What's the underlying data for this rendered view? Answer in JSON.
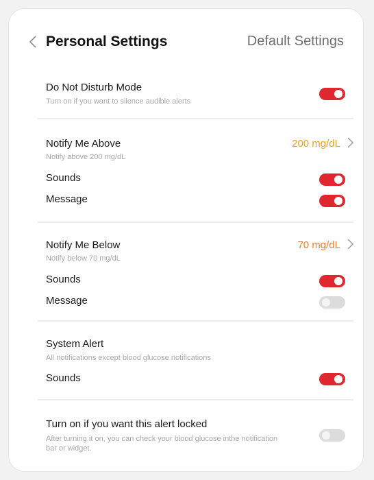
{
  "header": {
    "title": "Personal Settings",
    "default_link": "Default Settings"
  },
  "dnd": {
    "title": "Do Not Disturb Mode",
    "subtitle": "Turn on if you want to silence audible alerts",
    "enabled": true
  },
  "above": {
    "title": "Notify Me Above",
    "subtitle": "Notify above 200 mg/dL",
    "value": "200 mg/dL",
    "value_color": "#e8a21c",
    "sounds_label": "Sounds",
    "sounds_on": true,
    "message_label": "Message",
    "message_on": true
  },
  "below": {
    "title": "Notify Me Below",
    "subtitle": "Notify below 70 mg/dL",
    "value": "70 mg/dL",
    "value_color": "#ef7d2a",
    "sounds_label": "Sounds",
    "sounds_on": true,
    "message_label": "Message",
    "message_on": false
  },
  "system": {
    "title": "System Alert",
    "subtitle": "All notifications except blood glucose notifications",
    "sounds_label": "Sounds",
    "sounds_on": true
  },
  "lock": {
    "title": "Turn on if you want this alert locked",
    "subtitle": "After turning it on, you can check your blood glucose inthe notification bar or widget.",
    "enabled": false
  },
  "colors": {
    "toggle_on": "#e0262e",
    "toggle_off": "#dcdcdc"
  }
}
